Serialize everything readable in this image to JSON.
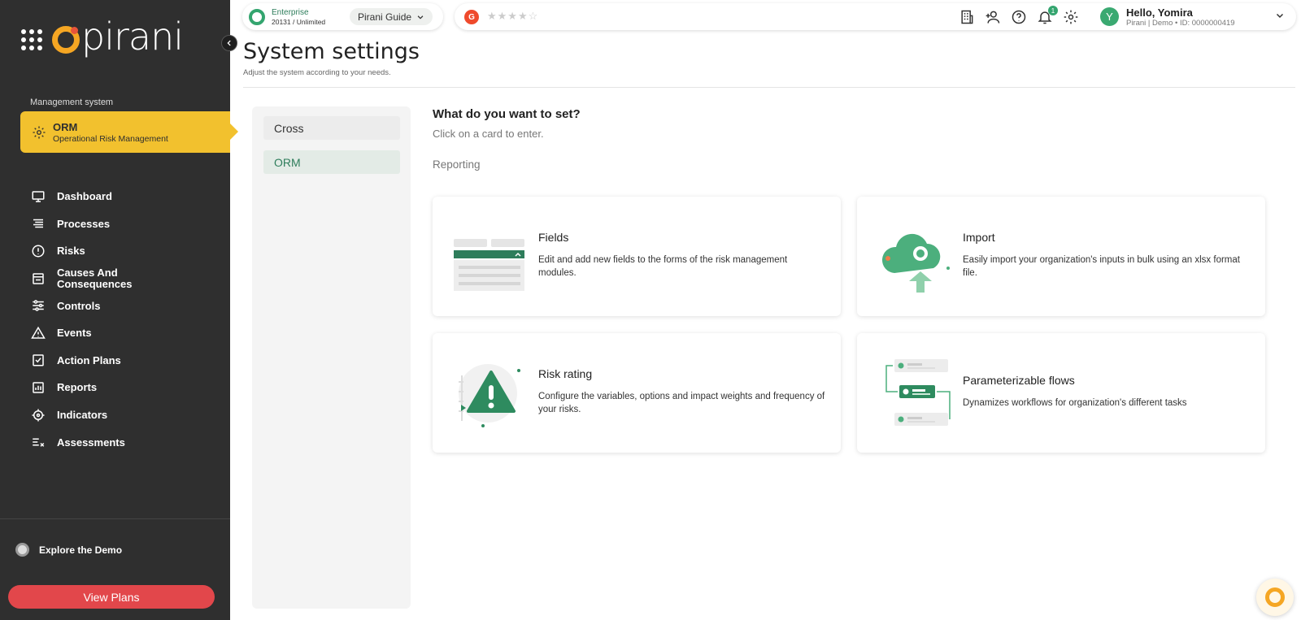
{
  "brand": {
    "name": "pirani"
  },
  "sidebar": {
    "management_label": "Management system",
    "active_system": {
      "title": "ORM",
      "subtitle": "Operational Risk Management"
    },
    "items": [
      {
        "label": "Dashboard",
        "icon": "monitor-icon"
      },
      {
        "label": "Processes",
        "icon": "list-icon"
      },
      {
        "label": "Risks",
        "icon": "alert-circle-icon"
      },
      {
        "label": "Causes And Consequences",
        "icon": "inbox-icon"
      },
      {
        "label": "Controls",
        "icon": "sliders-icon"
      },
      {
        "label": "Events",
        "icon": "warning-triangle-icon"
      },
      {
        "label": "Action Plans",
        "icon": "checklist-icon"
      },
      {
        "label": "Reports",
        "icon": "bar-chart-icon"
      },
      {
        "label": "Indicators",
        "icon": "crosshair-icon"
      },
      {
        "label": "Assessments",
        "icon": "assessment-icon"
      }
    ],
    "explore_label": "Explore the Demo",
    "view_plans_label": "View Plans"
  },
  "topbar": {
    "plan_title": "Enterprise",
    "plan_sub": "20131 / Unlimited",
    "guide_label": "Pirani Guide",
    "g2_label": "G",
    "stars": "★★★★☆",
    "notification_count": "1",
    "user_initial": "Y",
    "hello": "Hello, Yomira",
    "user_sub": "Pirani | Demo • ID: 0000000419"
  },
  "page": {
    "title": "System settings",
    "subtitle": "Adjust the system according to your needs."
  },
  "left_panel": {
    "items": [
      "Cross",
      "ORM"
    ]
  },
  "main": {
    "question": "What do you want to set?",
    "hint": "Click on a card to enter.",
    "section": "Reporting",
    "cards": [
      {
        "title": "Fields",
        "desc": "Edit and add new fields to the forms of the risk management modules."
      },
      {
        "title": "Import",
        "desc": "Easily import your organization's inputs in bulk using an xlsx format file."
      },
      {
        "title": "Risk rating",
        "desc": "Configure the variables, options and impact weights and frequency of your risks."
      },
      {
        "title": "Parameterizable flows",
        "desc": "Dynamizes workflows for organization's different tasks"
      }
    ]
  },
  "colors": {
    "accent_green": "#34a56f",
    "sidebar_bg": "#2f2f2f",
    "active_yellow": "#f2c12e",
    "cta_red": "#e2474b"
  }
}
